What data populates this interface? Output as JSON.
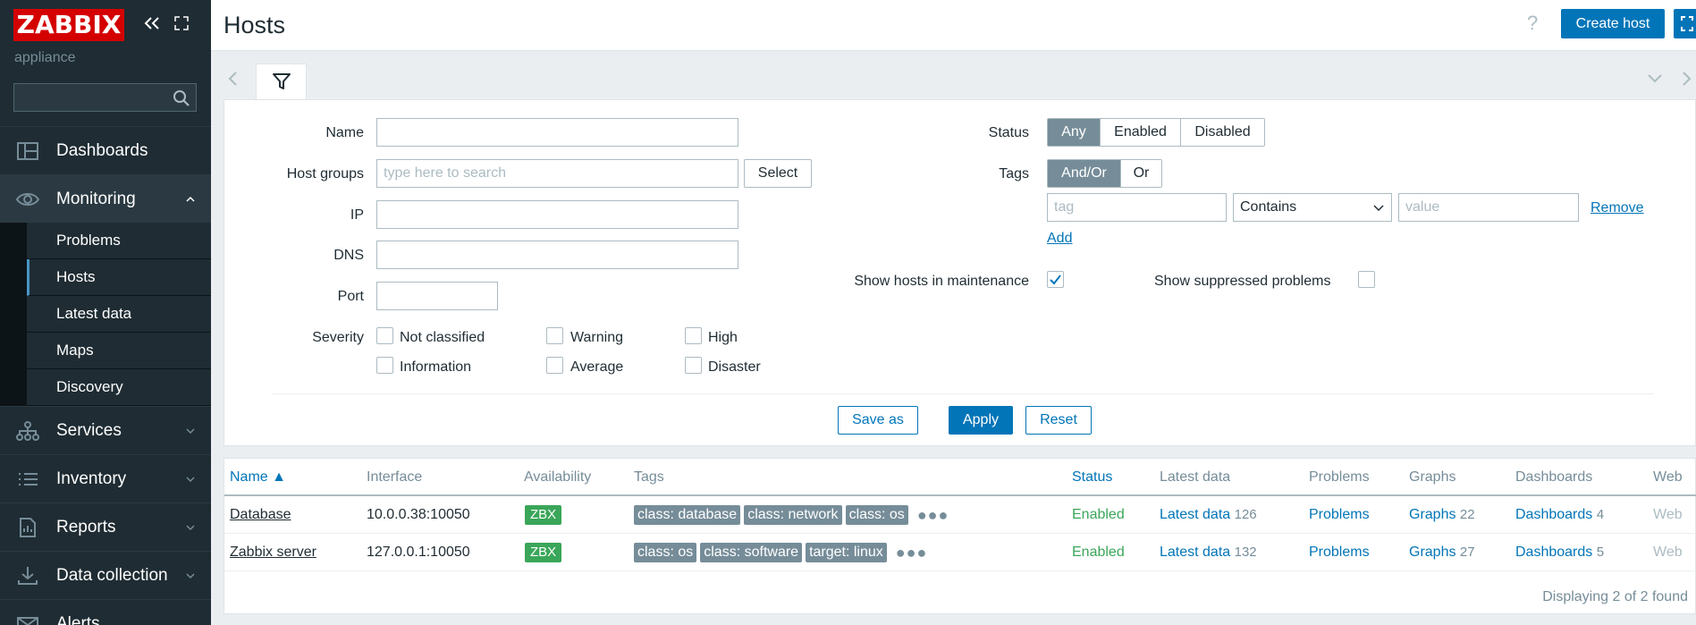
{
  "sidebar": {
    "logo": "ZABBIX",
    "subtitle": "appliance",
    "search_value": "",
    "menu": [
      {
        "label": "Dashboards",
        "icon": "dashboards-icon"
      },
      {
        "label": "Monitoring",
        "icon": "eye-icon"
      },
      {
        "label": "Services",
        "icon": "services-icon"
      },
      {
        "label": "Inventory",
        "icon": "list-icon"
      },
      {
        "label": "Reports",
        "icon": "report-icon"
      },
      {
        "label": "Data collection",
        "icon": "download-icon"
      },
      {
        "label": "Alerts",
        "icon": "envelope-icon"
      }
    ],
    "monitoring_sub": [
      "Problems",
      "Hosts",
      "Latest data",
      "Maps",
      "Discovery"
    ]
  },
  "header": {
    "title": "Hosts",
    "help": "?",
    "create_label": "Create host"
  },
  "filter": {
    "name_label": "Name",
    "name_value": "",
    "host_groups_label": "Host groups",
    "host_groups_placeholder": "type here to search",
    "select_label": "Select",
    "ip_label": "IP",
    "dns_label": "DNS",
    "port_label": "Port",
    "severity_label": "Severity",
    "severities": [
      "Not classified",
      "Warning",
      "High",
      "Information",
      "Average",
      "Disaster"
    ],
    "status_label": "Status",
    "status_options": [
      "Any",
      "Enabled",
      "Disabled"
    ],
    "status_selected": "Any",
    "tags_label": "Tags",
    "tags_options": [
      "And/Or",
      "Or"
    ],
    "tag_placeholder": "tag",
    "tag_operator": "Contains",
    "value_placeholder": "value",
    "remove_label": "Remove",
    "add_label": "Add",
    "maintenance_label": "Show hosts in maintenance",
    "maintenance_checked": true,
    "suppressed_label": "Show suppressed problems",
    "suppressed_checked": false,
    "save_as_label": "Save as",
    "apply_label": "Apply",
    "reset_label": "Reset"
  },
  "table": {
    "headers": [
      "Name ▲",
      "Interface",
      "Availability",
      "Tags",
      "Status",
      "Latest data",
      "Problems",
      "Graphs",
      "Dashboards",
      "Web"
    ],
    "rows": [
      {
        "name": "Database",
        "interface": "10.0.0.38:10050",
        "availability": "ZBX",
        "tags": [
          "class: database",
          "class: network",
          "class: os"
        ],
        "status": "Enabled",
        "latest_label": "Latest data",
        "latest_count": "126",
        "problems": "Problems",
        "graphs_label": "Graphs",
        "graphs_count": "22",
        "dashboards_label": "Dashboards",
        "dashboards_count": "4",
        "web": "Web"
      },
      {
        "name": "Zabbix server",
        "interface": "127.0.0.1:10050",
        "availability": "ZBX",
        "tags": [
          "class: os",
          "class: software",
          "target: linux"
        ],
        "status": "Enabled",
        "latest_label": "Latest data",
        "latest_count": "132",
        "problems": "Problems",
        "graphs_label": "Graphs",
        "graphs_count": "27",
        "dashboards_label": "Dashboards",
        "dashboards_count": "5",
        "web": "Web"
      }
    ],
    "footer": "Displaying 2 of 2 found"
  },
  "colors": {
    "sidebar_bg": "#1f2c33",
    "accent": "#0275b8",
    "logo_red": "#d40000",
    "ok_green": "#3aa659",
    "tag_grey": "#768d99"
  }
}
